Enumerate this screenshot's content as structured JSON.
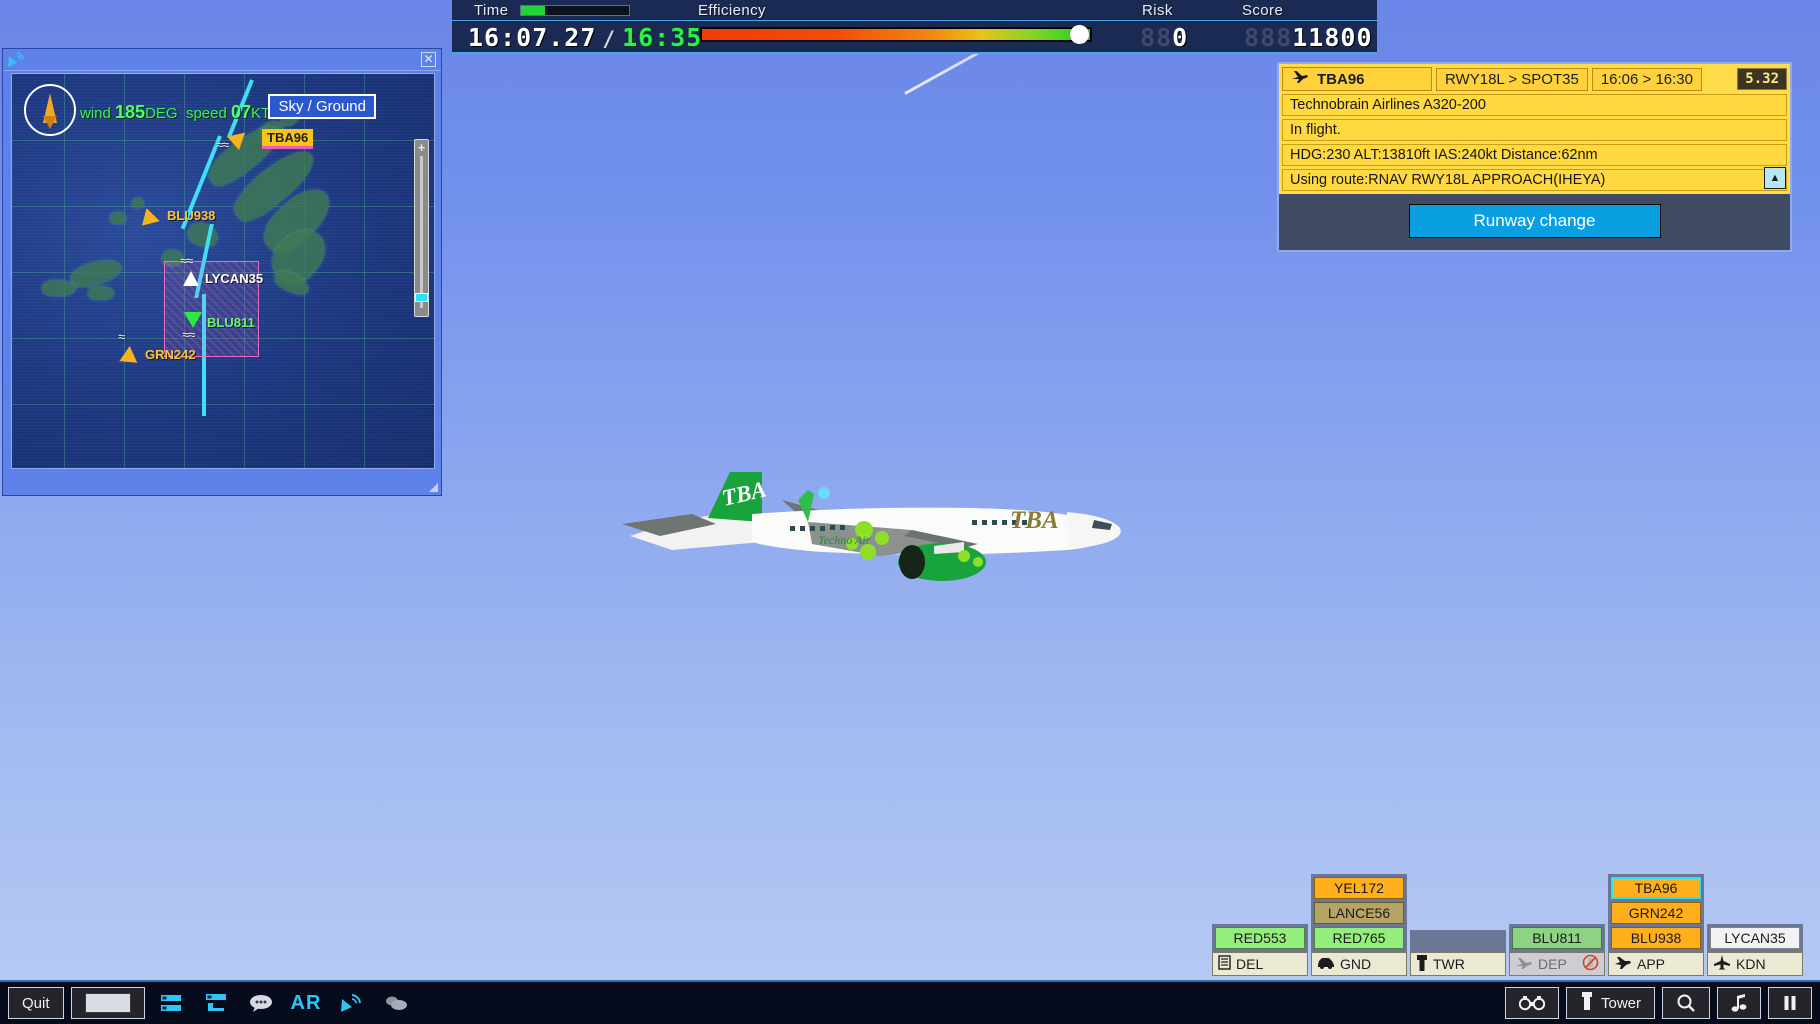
{
  "hud": {
    "time_label": "Time",
    "efficiency_label": "Efficiency",
    "risk_label": "Risk",
    "score_label": "Score",
    "clock_current": "16:07.27",
    "clock_separator": "/",
    "clock_goal": "16:35",
    "time_progress_pct": 22,
    "efficiency_pct": 97,
    "risk_value": "0",
    "risk_placeholder": "88",
    "score_value": "11800",
    "score_placeholder": "888"
  },
  "radar": {
    "dish_icon": "radar-dish-icon",
    "close_icon": "close-icon",
    "wind_prefix": "wind",
    "wind_deg": "185",
    "wind_deg_unit": "DEG",
    "speed_prefix": "speed",
    "speed_value": "07",
    "speed_unit": "KT",
    "sky_ground_label": "Sky / Ground",
    "zoom_plus": "+",
    "contacts": [
      {
        "callsign": "TBA96",
        "style": "selected"
      },
      {
        "callsign": "BLU938",
        "style": "yellow"
      },
      {
        "callsign": "LYCAN35",
        "style": "white"
      },
      {
        "callsign": "BLU811",
        "style": "green"
      },
      {
        "callsign": "GRN242",
        "style": "yellow"
      }
    ]
  },
  "flight_strip": {
    "plane_icon": "airplane-icon",
    "callsign": "TBA96",
    "route": "RWY18L > SPOT35",
    "times": "16:06 > 16:30",
    "timer_badge": "5.32",
    "aircraft_type": "Technobrain Airlines A320-200",
    "status": "In flight.",
    "telemetry": "HDG:230 ALT:13810ft IAS:240kt Distance:62nm",
    "route_info": "Using route:RNAV RWY18L APPROACH(IHEYA)",
    "scroll_icon": "triangle-up-icon",
    "runway_change_label": "Runway change"
  },
  "board": {
    "columns": [
      {
        "id": "del",
        "label": "DEL",
        "icon": "document-icon",
        "dim": false,
        "no_entry": false,
        "strips": [
          {
            "callsign": "RED553",
            "color": "green",
            "selected": false
          }
        ]
      },
      {
        "id": "gnd",
        "label": "GND",
        "icon": "car-icon",
        "dim": false,
        "no_entry": false,
        "strips": [
          {
            "callsign": "YEL172",
            "color": "orange",
            "selected": false
          },
          {
            "callsign": "LANCE56",
            "color": "khaki",
            "selected": false
          },
          {
            "callsign": "RED765",
            "color": "green",
            "selected": false
          }
        ]
      },
      {
        "id": "twr",
        "label": "TWR",
        "icon": "tower-icon",
        "dim": false,
        "no_entry": false,
        "strips": []
      },
      {
        "id": "dep",
        "label": "DEP",
        "icon": "departure-icon",
        "dim": true,
        "no_entry": true,
        "strips": [
          {
            "callsign": "BLU811",
            "color": "dgreen",
            "selected": false
          }
        ]
      },
      {
        "id": "app",
        "label": "APP",
        "icon": "approach-icon",
        "dim": false,
        "no_entry": false,
        "strips": [
          {
            "callsign": "TBA96",
            "color": "orange",
            "selected": true
          },
          {
            "callsign": "GRN242",
            "color": "orange",
            "selected": false
          },
          {
            "callsign": "BLU938",
            "color": "orange",
            "selected": false
          }
        ]
      },
      {
        "id": "kdn",
        "label": "KDN",
        "icon": "jet-icon",
        "dim": false,
        "no_entry": false,
        "strips": [
          {
            "callsign": "LYCAN35",
            "color": "white",
            "selected": false
          }
        ]
      }
    ]
  },
  "toolbar": {
    "quit_label": "Quit",
    "tower_label": "Tower",
    "left_icons": [
      "blank-screen-icon",
      "strips-list-icon",
      "flight-plan-icon",
      "chat-icon",
      "ar-icon",
      "radar-dish-icon",
      "clouds-icon"
    ],
    "ar_label": "AR",
    "right_icons": [
      "binoculars-icon",
      "tower-icon",
      "search-icon",
      "music-icon",
      "pause-icon"
    ]
  },
  "aircraft": {
    "tail_text": "TBA",
    "fuselage_text": "TBA",
    "sub_text": "Techno Air"
  },
  "colors": {
    "hud_bg": "#1b2a52",
    "accent_cyan": "#4aa6e8",
    "strip_yellow": "#ffd93f",
    "button_blue": "#0a9fe0",
    "selected_outline": "#23e3f5",
    "sky_top": "#6a86e8",
    "sky_bottom": "#b8cbf4",
    "livery_green": "#18a33c"
  }
}
